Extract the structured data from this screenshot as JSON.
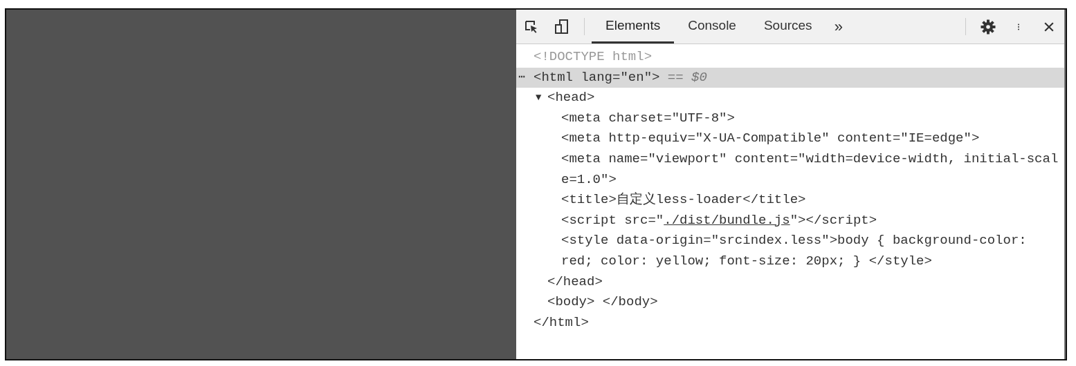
{
  "toolbar": {
    "tabs": [
      {
        "label": "Elements",
        "selected": true
      },
      {
        "label": "Console",
        "selected": false
      },
      {
        "label": "Sources",
        "selected": false
      }
    ],
    "more": "»"
  },
  "dom": [
    {
      "dimmed": true,
      "selected": false,
      "lines": [
        "<!DOCTYPE html>"
      ]
    },
    {
      "dimmed": false,
      "selected": true,
      "menu": "⋯",
      "lines": [
        "<html lang=\"en\">"
      ],
      "suffix": "== *$0*",
      "children": [
        {
          "dimmed": false,
          "selected": false,
          "toggle": "▼",
          "lines": [
            "<head>"
          ],
          "children": [
            {
              "dimmed": false,
              "selected": false,
              "lines": [
                "<meta charset=\"UTF-8\">"
              ]
            },
            {
              "dimmed": false,
              "selected": false,
              "lines": [
                "<meta http-equiv=\"X-UA-Compatible\" content=\"IE=edge\">"
              ]
            },
            {
              "dimmed": false,
              "selected": false,
              "lines": [
                "<meta name=\"viewport\" content=\"width=device-width, initial-scal",
                "e=1.0\">"
              ]
            },
            {
              "dimmed": false,
              "selected": false,
              "lines": [
                "<title>自定义less-loader</title>"
              ]
            },
            {
              "dimmed": false,
              "selected": false,
              "segments": [
                {
                  "text": "<script src=\"",
                  "link": false
                },
                {
                  "text": "./dist/bundle.js",
                  "link": true
                },
                {
                  "text": "\"></script>",
                  "link": false
                }
              ]
            },
            {
              "dimmed": false,
              "selected": false,
              "lines": [
                "<style data-origin=\"srcindex.less\">body { background-color:",
                "red; color: yellow; font-size: 20px; } </style>"
              ]
            }
          ]
        },
        {
          "dimmed": false,
          "selected": false,
          "lines": [
            "</head>"
          ]
        },
        {
          "dimmed": false,
          "selected": false,
          "lines": [
            "<body> </body>"
          ]
        }
      ]
    },
    {
      "dimmed": false,
      "selected": false,
      "lines": [
        "</html>"
      ]
    }
  ]
}
